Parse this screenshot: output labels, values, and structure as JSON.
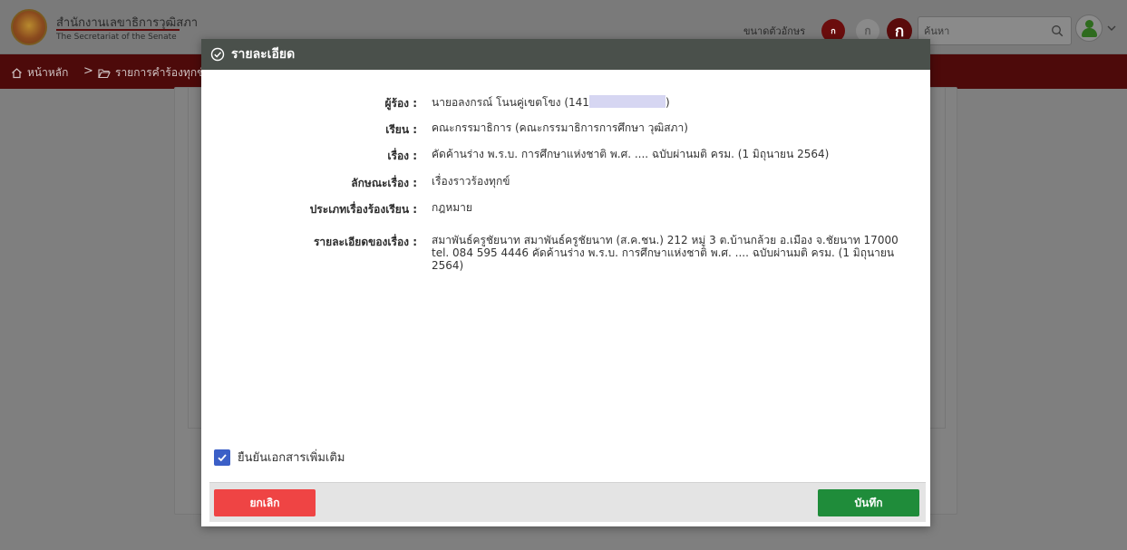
{
  "header": {
    "org_name_th": "สำนักงานเลขาธิการวุฒิสภา",
    "org_name_en": "The Secretariat of the Senate",
    "font_size_label": "ขนาดตัวอักษร",
    "font_small": "ก",
    "font_medium": "ก",
    "font_large": "ก",
    "search_placeholder": "ค้นหา"
  },
  "breadcrumb": {
    "home": "หน้าหลัก",
    "separator": ">",
    "list": "รายการคำร้องทุกข์"
  },
  "modal": {
    "title": "รายละเอียด",
    "fields": [
      {
        "label": "ผู้ร้อง :",
        "value": "นายอลงกรณ์ โนนคู่เขตโขง (141",
        "value_suffix": ")"
      },
      {
        "label": "เรียน :",
        "value": "คณะกรรมาธิการ (คณะกรรมาธิการการศึกษา วุฒิสภา)"
      },
      {
        "label": "เรื่อง :",
        "value": "คัดค้านร่าง พ.ร.บ. การศึกษาแห่งชาติ พ.ศ. .... ฉบับผ่านมติ ครม. (1 มิถุนายน 2564)"
      },
      {
        "label": "ลักษณะเรื่อง :",
        "value": "เรื่องราวร้องทุกข์"
      },
      {
        "label": "ประเภทเรื่องร้องเรียน :",
        "value": "กฎหมาย"
      },
      {
        "label": "รายละเอียดของเรื่อง :",
        "value": "สมาพันธ์ครูชัยนาท สมาพันธ์ครูชัยนาท (ส.ค.ชน.) 212 หมู่ 3 ต.บ้านกล้วย อ.เมือง จ.ชัยนาท 17000 tel. 084 595 4446 คัดค้านร่าง พ.ร.บ. การศึกษาแห่งชาติ พ.ศ. .... ฉบับผ่านมติ ครม. (1 มิถุนายน 2564)"
      }
    ],
    "confirm_label": "ยืนยันเอกสารเพิ่มเติม",
    "confirm_checked": true,
    "cancel_label": "ยกเลิก",
    "save_label": "บันทึก"
  },
  "colors": {
    "nav_bg": "#4d0a0a",
    "modal_header_bg": "#4a504b",
    "cancel_bg": "#ef4444",
    "save_bg": "#1f8c3a",
    "checkbox_bg": "#3b5fc7"
  }
}
